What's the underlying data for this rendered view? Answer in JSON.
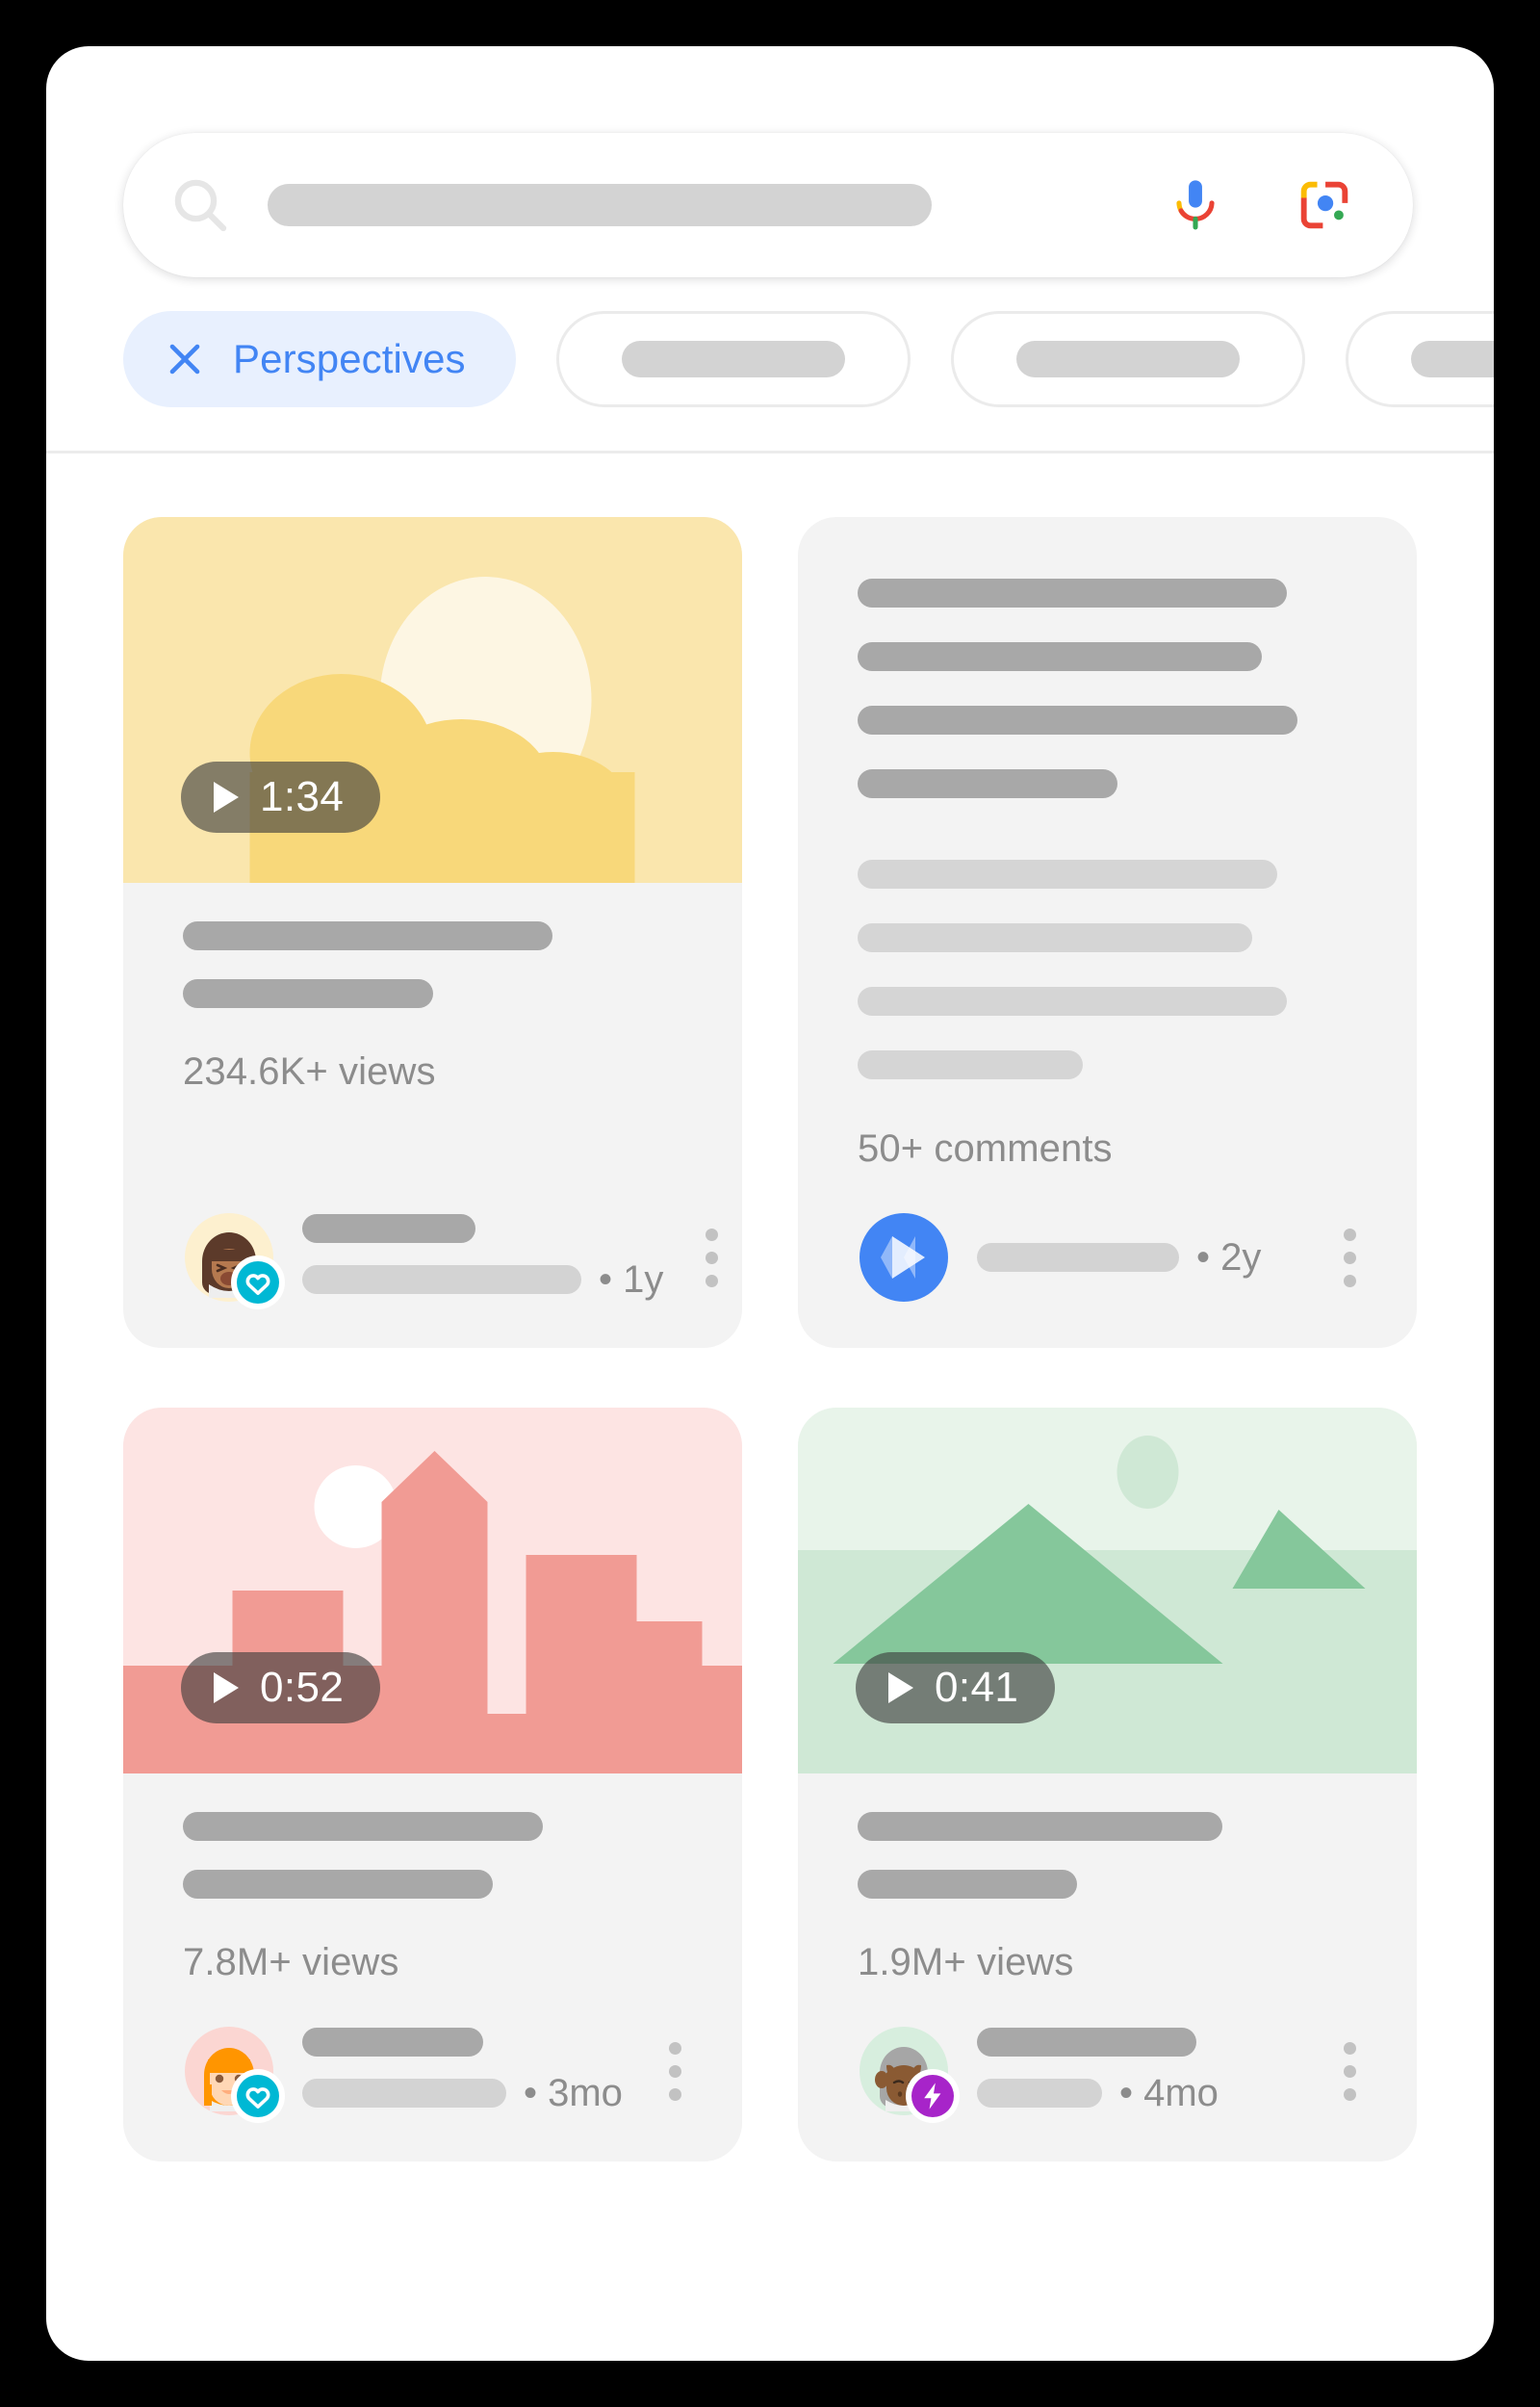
{
  "theme": {
    "accent_blue": "#4285f4",
    "chip_active_bg": "#e8f0fe",
    "card_bg": "#f3f3f3",
    "page_bg": "#000000",
    "surface_bg": "#ffffff",
    "badge_cyan": "#00b8d4",
    "badge_purple": "#a724c9"
  },
  "search": {
    "icon": "search-icon",
    "placeholder": "",
    "value": "",
    "mic_icon": "microphone-icon",
    "lens_icon": "google-lens-icon"
  },
  "filter_chips": [
    {
      "label": "Perspectives",
      "icon": "close-icon",
      "active": true
    },
    {
      "label": "",
      "active": false
    },
    {
      "label": "",
      "active": false
    },
    {
      "label": "",
      "active": false
    }
  ],
  "results": [
    {
      "id": "card-video-clouds",
      "type": "video",
      "thumbnail": "clouds-sun-illustration",
      "duration": "1:34",
      "play_icon": "play-icon",
      "stat": "234.6K+ views",
      "avatar": "woman-dark-hair-avatar",
      "avatar_badge": "heart-badge-icon",
      "age": "• 1y",
      "menu_icon": "more-options-icon"
    },
    {
      "id": "card-text-comments",
      "type": "text",
      "thumbnail": null,
      "duration": null,
      "stat": "50+ comments",
      "avatar": "play-store-avatar",
      "avatar_badge": null,
      "age": "• 2y",
      "menu_icon": "more-options-icon"
    },
    {
      "id": "card-video-city",
      "type": "video",
      "thumbnail": "pink-cityscape-illustration",
      "duration": "0:52",
      "play_icon": "play-icon",
      "stat": "7.8M+ views",
      "avatar": "woman-orange-hair-avatar",
      "avatar_badge": "heart-badge-icon",
      "age": "• 3mo",
      "menu_icon": "more-options-icon"
    },
    {
      "id": "card-video-mountains",
      "type": "video",
      "thumbnail": "green-mountains-illustration",
      "duration": "0:41",
      "play_icon": "play-icon",
      "stat": "1.9M+ views",
      "avatar": "buffalo-avatar",
      "avatar_badge": "lightning-badge-icon",
      "age": "• 4mo",
      "menu_icon": "more-options-icon"
    }
  ]
}
